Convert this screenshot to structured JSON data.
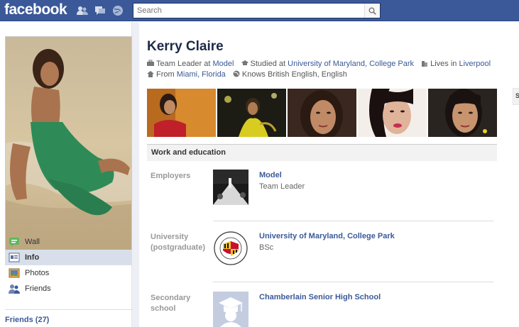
{
  "header": {
    "logo": "facebook",
    "search_placeholder": "Search"
  },
  "profile": {
    "name": "Kerry Claire",
    "facts": {
      "work_prefix": "Team Leader at",
      "work_link": "Model",
      "study_prefix": "Studied at",
      "study_link": "University of Maryland, College Park",
      "lives_prefix": "Lives in",
      "lives_link": "Liverpool",
      "from_prefix": "From",
      "from_link": "Miami, Florida",
      "languages": "Knows British English, English"
    }
  },
  "sidebar": {
    "items": [
      {
        "label": "Wall",
        "icon": "wall-icon"
      },
      {
        "label": "Info",
        "icon": "info-icon",
        "active": true
      },
      {
        "label": "Photos",
        "icon": "photos-icon"
      },
      {
        "label": "Friends",
        "icon": "friends-icon"
      }
    ],
    "friends_link": "Friends (27)"
  },
  "work_education": {
    "heading": "Work and education",
    "entries": [
      {
        "key": "Employers",
        "title": "Model",
        "sub": "Team Leader"
      },
      {
        "key": "University (postgraduate)",
        "title": "University of Maryland, College Park",
        "sub": "BSc"
      },
      {
        "key": "Secondary school",
        "title": "Chamberlain Senior High School",
        "sub": ""
      }
    ]
  },
  "right_stub": "S",
  "colors": {
    "brand": "#3b5998",
    "link": "#3b5998",
    "nav_active": "#d8dfea"
  }
}
